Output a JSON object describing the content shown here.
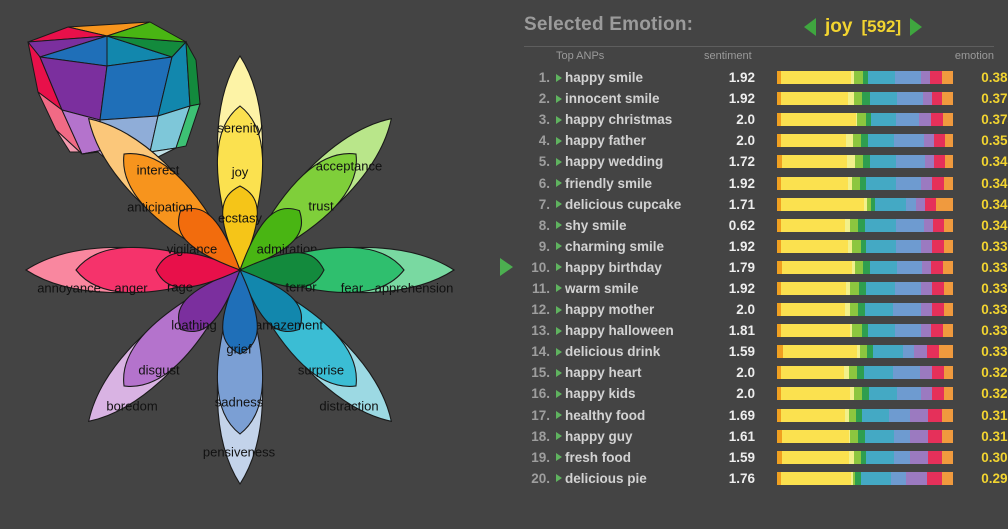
{
  "header": {
    "selected_emotion_label": "Selected Emotion:",
    "emotion_name": "joy",
    "emotion_count": "[592]",
    "prev_icon": "triangle-left-icon",
    "next_icon": "triangle-right-icon",
    "accent_yellow": "#f2d430",
    "accent_green": "#3fa63f"
  },
  "columns": {
    "rank": "",
    "anp": "Top ANPs",
    "sentiment": "sentiment",
    "bar": "",
    "emotion": "emotion"
  },
  "marker": {
    "icon": "triangle-right-marker-icon",
    "row_index": 10
  },
  "rows": [
    {
      "rank": "1.",
      "anp": "happy smile",
      "sentiment": "1.92",
      "emotion": "0.388",
      "segments": [
        3,
        53,
        2,
        7,
        4,
        20,
        20,
        7,
        9,
        8
      ]
    },
    {
      "rank": "2.",
      "anp": "innocent smile",
      "sentiment": "1.92",
      "emotion": "0.376",
      "segments": [
        3,
        51,
        4,
        6,
        6,
        21,
        19,
        7,
        8,
        8
      ]
    },
    {
      "rank": "3.",
      "anp": "happy christmas",
      "sentiment": "2.0",
      "emotion": "0.373",
      "segments": [
        3,
        55,
        1,
        6,
        4,
        18,
        17,
        9,
        9,
        7
      ]
    },
    {
      "rank": "4.",
      "anp": "happy father",
      "sentiment": "2.0",
      "emotion": "0.358",
      "segments": [
        3,
        49,
        5,
        6,
        5,
        20,
        22,
        8,
        8,
        6
      ]
    },
    {
      "rank": "5.",
      "anp": "happy wedding",
      "sentiment": "1.72",
      "emotion": "0.348",
      "segments": [
        4,
        49,
        6,
        6,
        5,
        20,
        22,
        7,
        8,
        6
      ]
    },
    {
      "rank": "6.",
      "anp": "friendly smile",
      "sentiment": "1.92",
      "emotion": "0.346",
      "segments": [
        3,
        50,
        3,
        6,
        5,
        22,
        19,
        8,
        9,
        7
      ]
    },
    {
      "rank": "7.",
      "anp": "delicious cupcake",
      "sentiment": "1.71",
      "emotion": "0.341",
      "segments": [
        3,
        60,
        2,
        3,
        3,
        22,
        7,
        7,
        8,
        12
      ]
    },
    {
      "rank": "8.",
      "anp": "shy smile",
      "sentiment": "0.62",
      "emotion": "0.340",
      "segments": [
        3,
        48,
        4,
        6,
        5,
        23,
        21,
        7,
        8,
        7
      ]
    },
    {
      "rank": "9.",
      "anp": "charming smile",
      "sentiment": "1.92",
      "emotion": "0.339",
      "segments": [
        3,
        50,
        3,
        7,
        4,
        22,
        19,
        8,
        9,
        7
      ]
    },
    {
      "rank": "10.",
      "anp": "happy birthday",
      "sentiment": "1.79",
      "emotion": "0.337",
      "segments": [
        4,
        52,
        2,
        6,
        5,
        20,
        19,
        7,
        9,
        7
      ]
    },
    {
      "rank": "11.",
      "anp": "warm smile",
      "sentiment": "1.92",
      "emotion": "0.336",
      "segments": [
        3,
        49,
        3,
        7,
        5,
        22,
        20,
        8,
        9,
        7
      ]
    },
    {
      "rank": "12.",
      "anp": "happy mother",
      "sentiment": "2.0",
      "emotion": "0.333",
      "segments": [
        3,
        48,
        4,
        6,
        5,
        21,
        21,
        8,
        9,
        7
      ]
    },
    {
      "rank": "13.",
      "anp": "happy halloween",
      "sentiment": "1.81",
      "emotion": "0.331",
      "segments": [
        3,
        51,
        2,
        7,
        5,
        20,
        19,
        8,
        9,
        7
      ]
    },
    {
      "rank": "14.",
      "anp": "delicious drink",
      "sentiment": "1.59",
      "emotion": "0.330",
      "segments": [
        4,
        54,
        2,
        5,
        4,
        22,
        8,
        9,
        9,
        10
      ]
    },
    {
      "rank": "15.",
      "anp": "happy heart",
      "sentiment": "2.0",
      "emotion": "0.329",
      "segments": [
        3,
        47,
        4,
        6,
        5,
        22,
        20,
        9,
        9,
        7
      ]
    },
    {
      "rank": "16.",
      "anp": "happy kids",
      "sentiment": "2.0",
      "emotion": "0.323",
      "segments": [
        3,
        52,
        3,
        6,
        5,
        21,
        18,
        8,
        9,
        7
      ]
    },
    {
      "rank": "17.",
      "anp": "healthy food",
      "sentiment": "1.69",
      "emotion": "0.312",
      "segments": [
        3,
        49,
        3,
        5,
        5,
        20,
        16,
        14,
        11,
        8
      ]
    },
    {
      "rank": "18.",
      "anp": "happy guy",
      "sentiment": "1.61",
      "emotion": "0.312",
      "segments": [
        4,
        50,
        1,
        6,
        5,
        22,
        12,
        13,
        11,
        8
      ]
    },
    {
      "rank": "19.",
      "anp": "fresh food",
      "sentiment": "1.59",
      "emotion": "0.307",
      "segments": [
        4,
        50,
        4,
        5,
        4,
        21,
        12,
        13,
        11,
        8
      ]
    },
    {
      "rank": "20.",
      "anp": "delicious pie",
      "sentiment": "1.76",
      "emotion": "0.296",
      "segments": [
        3,
        51,
        1,
        2,
        4,
        22,
        11,
        15,
        11,
        8
      ]
    }
  ],
  "bar_palette": [
    "#f0a020",
    "#fbe14f",
    "#f2f08a",
    "#8cc63f",
    "#2e9e4f",
    "#44a9c4",
    "#6e9bd0",
    "#9b7ac0",
    "#e5305a",
    "#f09a3e"
  ],
  "wheel": {
    "title": "plutchik-emotion-wheel",
    "petals": [
      {
        "name": "joy",
        "inner": "ecstasy",
        "mid": "joy",
        "outer": "serenity",
        "colors": [
          "#f5c518",
          "#fbe14f",
          "#fdf3a6"
        ]
      },
      {
        "name": "trust",
        "inner": "admiration",
        "mid": "trust",
        "outer": "acceptance",
        "colors": [
          "#49b513",
          "#7fcf3a",
          "#b9e68a"
        ]
      },
      {
        "name": "fear",
        "inner": "terror",
        "mid": "fear",
        "outer": "apprehension",
        "colors": [
          "#138a3d",
          "#2fbf6e",
          "#79d9a1"
        ]
      },
      {
        "name": "surprise",
        "inner": "amazement",
        "mid": "surprise",
        "outer": "distraction",
        "colors": [
          "#1287ad",
          "#3bbdd4",
          "#9cd9e3"
        ]
      },
      {
        "name": "sadness",
        "inner": "grief",
        "mid": "sadness",
        "outer": "pensiveness",
        "colors": [
          "#1f6fb8",
          "#7b9fd4",
          "#c3d3ea"
        ]
      },
      {
        "name": "disgust",
        "inner": "loathing",
        "mid": "disgust",
        "outer": "boredom",
        "colors": [
          "#7b2f9e",
          "#b473cc",
          "#d9b3e3"
        ]
      },
      {
        "name": "anger",
        "inner": "rage",
        "mid": "anger",
        "outer": "annoyance",
        "colors": [
          "#e8104a",
          "#f5336b",
          "#f9879f"
        ]
      },
      {
        "name": "anticipation",
        "inner": "vigilance",
        "mid": "anticipation",
        "outer": "interest",
        "colors": [
          "#f26c0d",
          "#f7941d",
          "#fbc77a"
        ]
      }
    ]
  },
  "cone": {
    "name": "plutchik-emotion-cone",
    "top_colors": [
      "#f5c518",
      "#49b513",
      "#138a3d",
      "#1287ad",
      "#1f6fb8",
      "#7b2f9e",
      "#e8104a",
      "#f7941d"
    ],
    "band_colors": [
      "#1f6fb8",
      "#1287ad",
      "#2fbf6e",
      "#7b2f9e",
      "#e8104a"
    ]
  },
  "background": "#444444"
}
